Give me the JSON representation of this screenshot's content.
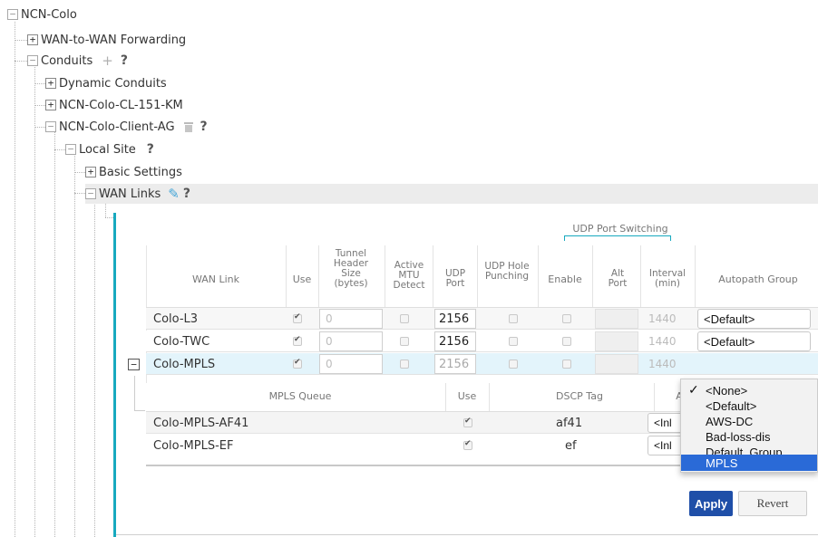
{
  "tree": {
    "root": "NCN-Colo",
    "wan_to_wan": "WAN-to-WAN Forwarding",
    "conduits": "Conduits",
    "dynamic_conduits": "Dynamic Conduits",
    "conduit_km": "NCN-Colo-CL-151-KM",
    "conduit_ag": "NCN-Colo-Client-AG",
    "local_site": "Local Site",
    "basic_settings": "Basic Settings",
    "wan_links": "WAN Links",
    "help": "?",
    "plus": "+",
    "minus": "−"
  },
  "table": {
    "group_header": "UDP Port Switching",
    "headers": {
      "wan_link": "WAN Link",
      "use": "Use",
      "tunnel_header": "Tunnel Header Size (bytes)",
      "active_mtu": "Active MTU Detect",
      "udp_port": "UDP Port",
      "udp_hole": "UDP Hole Punching",
      "enable": "Enable",
      "alt_port": "Alt Port",
      "interval": "Interval (min)",
      "autopath": "Autopath Group"
    },
    "rows": [
      {
        "name": "Colo-L3",
        "use": true,
        "tunnel": "0",
        "mtu": false,
        "udp": "2156",
        "hole": false,
        "enable": false,
        "interval": "1440",
        "autopath": "<Default>"
      },
      {
        "name": "Colo-TWC",
        "use": true,
        "tunnel": "0",
        "mtu": false,
        "udp": "2156",
        "hole": false,
        "enable": false,
        "interval": "1440",
        "autopath": "<Default>"
      },
      {
        "name": "Colo-MPLS",
        "use": true,
        "tunnel": "0",
        "mtu": false,
        "udp": "2156",
        "hole": false,
        "enable": false,
        "interval": "1440"
      }
    ]
  },
  "mpls": {
    "headers": {
      "queue": "MPLS Queue",
      "use": "Use",
      "dscp": "DSCP Tag",
      "a": "A"
    },
    "rows": [
      {
        "name": "Colo-MPLS-AF41",
        "use": true,
        "dscp": "af41",
        "partial": "<Inl"
      },
      {
        "name": "Colo-MPLS-EF",
        "use": true,
        "dscp": "ef",
        "partial": "<Inl"
      }
    ]
  },
  "dropdown": {
    "options": [
      "<None>",
      "<Default>",
      "AWS-DC",
      "Bad-loss-dis",
      "Default_Group",
      "MPLS"
    ],
    "checked": "<None>",
    "highlighted": "MPLS",
    "check_glyph": "✓"
  },
  "buttons": {
    "apply": "Apply",
    "revert": "Revert"
  },
  "colors": {
    "accent": "#17a9bf",
    "apply": "#1f4fa8",
    "highlight": "#2a6ad7",
    "selected_row": "#e3f4fb"
  }
}
